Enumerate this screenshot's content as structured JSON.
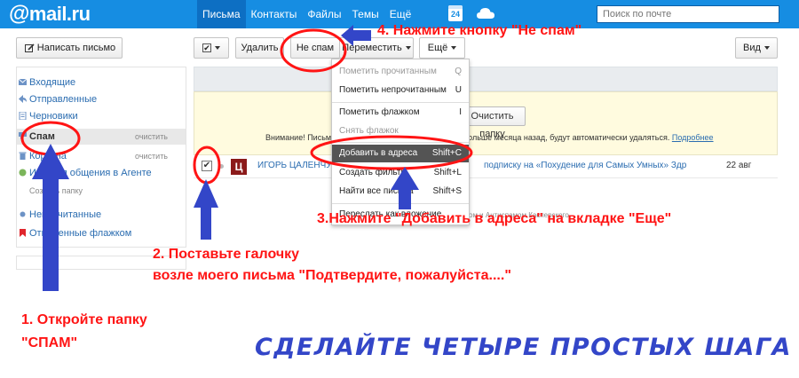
{
  "header": {
    "logo_at": "@",
    "logo_text": "mail.ru",
    "nav": [
      {
        "label": "Письма",
        "active": true
      },
      {
        "label": "Контакты",
        "active": false
      },
      {
        "label": "Файлы",
        "active": false
      },
      {
        "label": "Темы",
        "active": false
      },
      {
        "label": "Ещё",
        "active": false
      }
    ],
    "calendar_day": "24",
    "search_placeholder": "Поиск по почте",
    "accent": "#168de2"
  },
  "toolbar": {
    "compose_label": "Написать письмо",
    "delete_label": "Удалить",
    "not_spam_label": "Не спам",
    "move_label": "Переместить",
    "more_label": "Ещё",
    "view_label": "Вид"
  },
  "sidebar": {
    "folders": [
      {
        "label": "Входящие",
        "icon": "inbox-icon"
      },
      {
        "label": "Отправленные",
        "icon": "sent-icon"
      },
      {
        "label": "Черновики",
        "icon": "drafts-icon"
      },
      {
        "label": "Спам",
        "icon": "spam-icon",
        "active": true,
        "clear": "очистить"
      },
      {
        "label": "Корзина",
        "icon": "trash-icon",
        "clear": "очистить"
      },
      {
        "label": "История общения в Агенте",
        "icon": "agent-icon"
      },
      {
        "label": "Создать папку",
        "icon": "none"
      },
      {
        "label": "Непрочитанные",
        "icon": "unread-dot-icon"
      },
      {
        "label": "Отмеченные флажком",
        "icon": "flag-icon"
      }
    ]
  },
  "notice": {
    "button_label": "Очистить папку",
    "text": "Внимание! Письма, которые были помещены в спам больше месяца назад, будут автоматически удаляться.",
    "link": "Подробнее"
  },
  "message": {
    "from": "ИГОРЬ ЦАЛЕНЧУК",
    "avatar_letter": "Ц",
    "subject": "подписку на «Похудение для Самых Умных» Здр",
    "date": "22 авг"
  },
  "faint_text": "ом и Антиспамом Касперского",
  "more_menu": {
    "items": [
      {
        "label": "Пометить прочитанным",
        "shortcut": "Q",
        "disabled": true
      },
      {
        "label": "Пометить непрочитанным",
        "shortcut": "U"
      },
      {
        "label": "Пометить флажком",
        "shortcut": "I"
      },
      {
        "label": "Снять флажок",
        "shortcut": "",
        "disabled": true
      },
      {
        "label": "Добавить в адреса",
        "shortcut": "Shift+C",
        "highlight": true
      },
      {
        "label": "Создать фильтр",
        "shortcut": "Shift+L"
      },
      {
        "label": "Найти все письма",
        "shortcut": "Shift+S"
      },
      {
        "label": "Переслать как вложение",
        "shortcut": ""
      }
    ]
  },
  "annotations": {
    "step1_line1": "1. Откройте папку",
    "step1_line2": "\"СПАМ\"",
    "step2_line1": "2. Поставьте галочку",
    "step2_line2": "возле моего письма \"Подтвердите, пожалуйста....\"",
    "step3": "3.Нажмите \"Добавить в адреса\" на вкладке \"Еще\"",
    "step4": "4. Нажмите кнопку \"Не спам\"",
    "title": "СДЕЛАЙТЕ ЧЕТЫРЕ ПРОСТЫХ ШАГА",
    "red": "#ff1414",
    "blue": "#3346c8"
  }
}
